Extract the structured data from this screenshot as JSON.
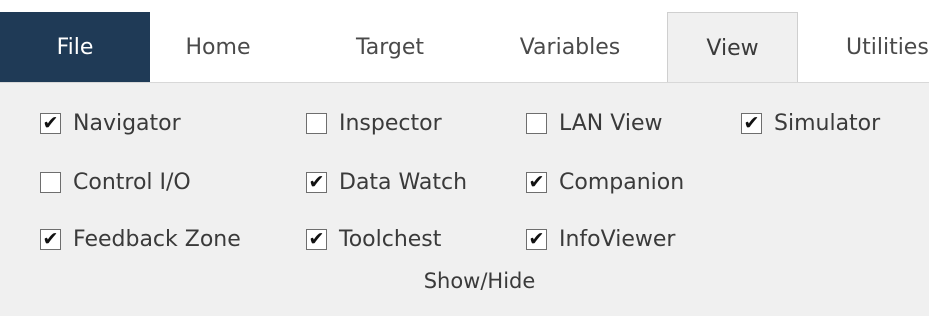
{
  "tabs": [
    {
      "label": "File"
    },
    {
      "label": "Home"
    },
    {
      "label": "Target"
    },
    {
      "label": "Variables"
    },
    {
      "label": "View"
    },
    {
      "label": "Utilities"
    }
  ],
  "active_tab": "View",
  "group": {
    "label": "Show/Hide",
    "checked_mark": "✔",
    "options": [
      {
        "label": "Navigator",
        "checked": true
      },
      {
        "label": "Inspector",
        "checked": false
      },
      {
        "label": "LAN View",
        "checked": false
      },
      {
        "label": "Simulator",
        "checked": true
      },
      {
        "label": "Control I/O",
        "checked": false
      },
      {
        "label": "Data Watch",
        "checked": true
      },
      {
        "label": "Companion",
        "checked": true
      },
      {
        "label": "Feedback Zone",
        "checked": true
      },
      {
        "label": "Toolchest",
        "checked": true
      },
      {
        "label": "InfoViewer",
        "checked": true
      }
    ]
  },
  "colors": {
    "file_tab_bg": "#1f3a56",
    "ribbon_bg": "#f0f0f0"
  }
}
